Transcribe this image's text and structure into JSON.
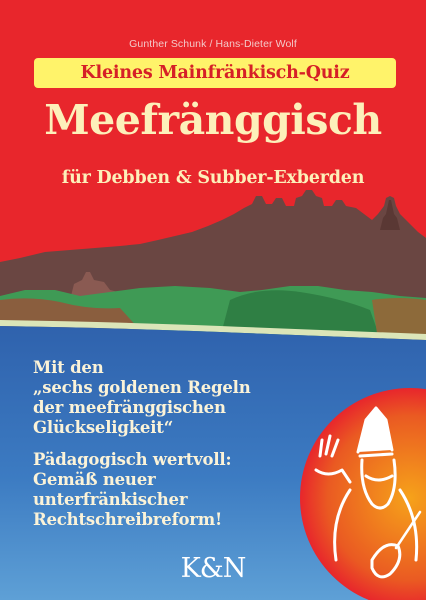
{
  "cover": {
    "authors": "Gunther Schunk / Hans-Dieter Wolf",
    "series": "Kleines Mainfränkisch-Quiz",
    "title": "Meefränggisch",
    "subtitle": "für Debben & Subber-Exberden",
    "blurb_1": "Mit den\n„sechs goldenen Regeln\nder meefränggischen\nGlückseligkeit“",
    "blurb_2": "Pädagogisch wertvoll:\nGemäß neuer\nunterfränkischer\nRechtschreibreform!",
    "publisher": "K&N"
  },
  "colors": {
    "background": "#e8262c",
    "badge": "#fff36a",
    "title": "#fdf0ba",
    "water": "#2b5ea8",
    "fortress": "#6e4a44",
    "hills": "#3d9a52"
  },
  "illustration": {
    "skyline": "fortress-silhouette",
    "river": "main-river",
    "figure": "bishop-with-quill"
  }
}
